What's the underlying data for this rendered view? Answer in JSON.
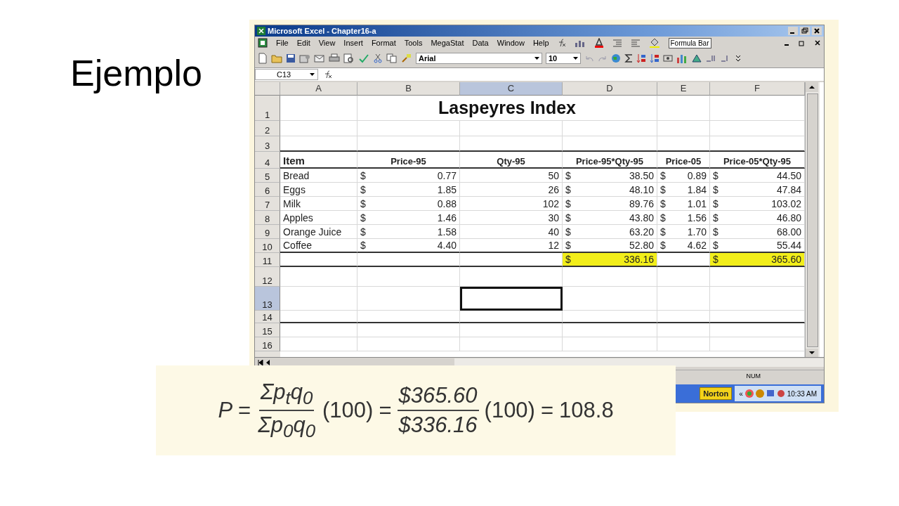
{
  "slide_title": "Ejemplo",
  "excel": {
    "title": "Microsoft Excel - Chapter16-a",
    "menu": [
      "File",
      "Edit",
      "View",
      "Insert",
      "Format",
      "Tools",
      "MegaStat",
      "Data",
      "Window",
      "Help"
    ],
    "formula_bar_button": "Formula Bar",
    "font": "Arial",
    "font_size": "10",
    "name_box": "C13",
    "columns": [
      {
        "label": "A",
        "selected": false
      },
      {
        "label": "B",
        "selected": false
      },
      {
        "label": "C",
        "selected": true
      },
      {
        "label": "D",
        "selected": false
      },
      {
        "label": "E",
        "selected": false
      },
      {
        "label": "F",
        "selected": false
      }
    ],
    "rows": [
      {
        "header": "1",
        "kind": "title",
        "selected": false,
        "title": "Laspeyres Index"
      },
      {
        "header": "2",
        "kind": "blank",
        "selected": false
      },
      {
        "header": "3",
        "kind": "blank",
        "selected": false
      },
      {
        "header": "4",
        "kind": "header",
        "selected": false,
        "cells": [
          {
            "text": "Item"
          },
          {
            "text": "Price-95"
          },
          {
            "text": "Qty-95"
          },
          {
            "text": "Price-95*Qty-95"
          },
          {
            "text": "Price-05"
          },
          {
            "text": "Price-05*Qty-95"
          }
        ]
      },
      {
        "header": "5",
        "kind": "data",
        "selected": false,
        "cells": [
          {
            "text": "Bread"
          },
          {
            "currency": "$",
            "text": "0.77"
          },
          {
            "text": "50"
          },
          {
            "currency": "$",
            "text": "38.50"
          },
          {
            "currency": "$",
            "text": "0.89"
          },
          {
            "currency": "$",
            "text": "44.50"
          }
        ]
      },
      {
        "header": "6",
        "kind": "data",
        "selected": false,
        "cells": [
          {
            "text": "Eggs"
          },
          {
            "currency": "$",
            "text": "1.85"
          },
          {
            "text": "26"
          },
          {
            "currency": "$",
            "text": "48.10"
          },
          {
            "currency": "$",
            "text": "1.84"
          },
          {
            "currency": "$",
            "text": "47.84"
          }
        ]
      },
      {
        "header": "7",
        "kind": "data",
        "selected": false,
        "cells": [
          {
            "text": "Milk"
          },
          {
            "currency": "$",
            "text": "0.88"
          },
          {
            "text": "102"
          },
          {
            "currency": "$",
            "text": "89.76"
          },
          {
            "currency": "$",
            "text": "1.01"
          },
          {
            "currency": "$",
            "text": "103.02"
          }
        ]
      },
      {
        "header": "8",
        "kind": "data",
        "selected": false,
        "cells": [
          {
            "text": "Apples"
          },
          {
            "currency": "$",
            "text": "1.46"
          },
          {
            "text": "30"
          },
          {
            "currency": "$",
            "text": "43.80"
          },
          {
            "currency": "$",
            "text": "1.56"
          },
          {
            "currency": "$",
            "text": "46.80"
          }
        ]
      },
      {
        "header": "9",
        "kind": "data",
        "selected": false,
        "cells": [
          {
            "text": "Orange Juice"
          },
          {
            "currency": "$",
            "text": "1.58"
          },
          {
            "text": "40"
          },
          {
            "currency": "$",
            "text": "63.20"
          },
          {
            "currency": "$",
            "text": "1.70"
          },
          {
            "currency": "$",
            "text": "68.00"
          }
        ]
      },
      {
        "header": "10",
        "kind": "data",
        "selected": false,
        "cells": [
          {
            "text": "Coffee"
          },
          {
            "currency": "$",
            "text": "4.40"
          },
          {
            "text": "12"
          },
          {
            "currency": "$",
            "text": "52.80"
          },
          {
            "currency": "$",
            "text": "4.62"
          },
          {
            "currency": "$",
            "text": "55.44"
          }
        ]
      },
      {
        "header": "11",
        "kind": "data",
        "selected": false,
        "cells": [
          {
            "highlighted": false
          },
          {
            "highlighted": false
          },
          {
            "highlighted": false
          },
          {
            "currency": "$",
            "text": "336.16",
            "highlighted": true
          },
          {
            "highlighted": false
          },
          {
            "currency": "$",
            "text": "365.60",
            "highlighted": true
          }
        ]
      },
      {
        "header": "12",
        "kind": "blank",
        "selected": false
      },
      {
        "header": "13",
        "kind": "blank",
        "selected": true
      },
      {
        "header": "14",
        "kind": "blank",
        "selected": false
      },
      {
        "header": "15",
        "kind": "blank",
        "selected": false
      },
      {
        "header": "16",
        "kind": "blank",
        "selected": false
      }
    ],
    "status": "NUM",
    "taskbar": {
      "button": "Norton",
      "chevron": "«",
      "clock": "10:33 AM"
    }
  },
  "formula": [
    {
      "kind": "variable",
      "text": "P"
    },
    {
      "kind": "operator",
      "text": "="
    },
    {
      "kind": "fraction",
      "numerator": "Σp$_{t}$q$_{0}$",
      "denominator": "Σp$_{0}$q$_{0}$"
    },
    {
      "kind": "operator",
      "text": "(100)"
    },
    {
      "kind": "operator",
      "text": "="
    },
    {
      "kind": "fraction",
      "numerator": "$365.60",
      "denominator": "$336.16"
    },
    {
      "kind": "operator",
      "text": "(100)"
    },
    {
      "kind": "operator",
      "text": "="
    },
    {
      "kind": "operator",
      "text": "108.8"
    }
  ]
}
